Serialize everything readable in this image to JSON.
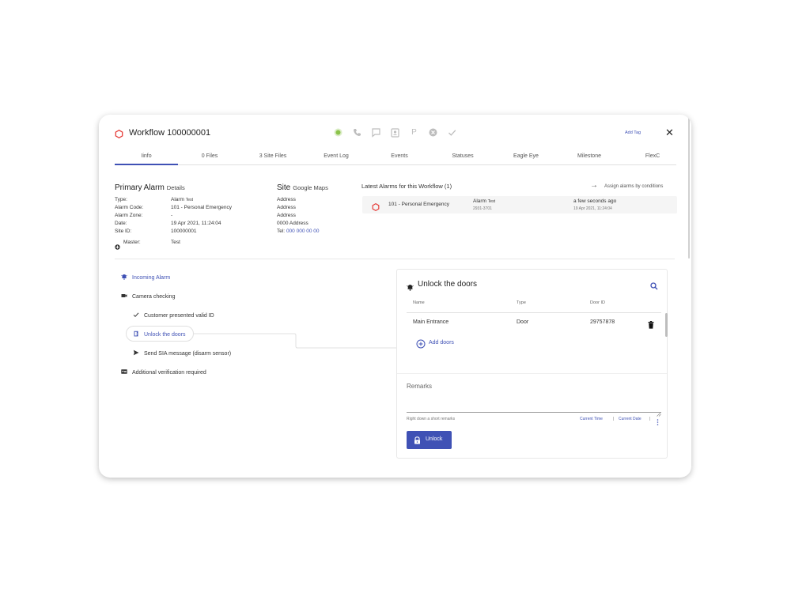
{
  "header": {
    "title": "Workflow 100000001",
    "add_tag": "Add Tag",
    "close_symbol": "✕",
    "toolbar_icons": [
      "status-dot-icon",
      "phone-icon",
      "chat-icon",
      "contact-icon",
      "parking-icon",
      "cancel-icon",
      "check-icon"
    ]
  },
  "tabs": [
    "Iinfo",
    "0 Files",
    "3 Site Files",
    "Event Log",
    "Events",
    "Statuses",
    "Eagle Eye",
    "Milestone",
    "FlexC"
  ],
  "primary_alarm": {
    "title": "Primary Alarm",
    "subtitle": "Details",
    "rows": [
      {
        "label": "Type:",
        "value": "Alarm",
        "extra": "Test"
      },
      {
        "label": "Alarm Code:",
        "value": "101 - Personal Emergency"
      },
      {
        "label": "Alarm Zone:",
        "value": "-"
      },
      {
        "label": "Date:",
        "value": "19 Apr 2021, 11:24:04"
      },
      {
        "label": "Site ID:",
        "value": "100000001"
      }
    ],
    "master_label": "Master:",
    "master_value": "Test"
  },
  "site": {
    "title": "Site",
    "subtitle": "Google Maps",
    "lines": [
      "Address",
      "Address",
      "Address",
      "0000 Address"
    ],
    "tel_label": "Tel:",
    "tel_value": "000 000 00 00"
  },
  "latest_alarms": {
    "title": "Latest Alarms for this Workflow (1)",
    "assign": "Assign alarms by conditions",
    "arrow": "→",
    "row": {
      "name": "101 - Personal Emergency",
      "type": "Alarm",
      "type_extra": "Test",
      "code": "2931-3701",
      "when": "a few seconds ago",
      "date": "19 Apr 2021, 11:24:04"
    }
  },
  "workflow_steps": [
    {
      "label": "Incoming Alarm",
      "icon": "alarm-bell-icon"
    },
    {
      "label": "Camera checking",
      "icon": "camera-icon"
    },
    {
      "label": "Customer presented valid ID",
      "icon": "check-icon"
    },
    {
      "label": "Unlock the doors",
      "icon": "door-icon"
    },
    {
      "label": "Send SIA message (disarm sensor)",
      "icon": "send-icon"
    },
    {
      "label": "Additional verification required",
      "icon": "id-card-icon"
    }
  ],
  "panel": {
    "title": "Unlock the doors",
    "columns": [
      "Name",
      "Type",
      "Door ID"
    ],
    "rows": [
      {
        "name": "Main Entrance",
        "type": "Door",
        "door_id": "29757878"
      }
    ],
    "add_doors": "Add doors",
    "remarks_label": "Remarks",
    "remarks_hint": "Right down a short remarks",
    "current_time": "Current Time",
    "current_date": "Current Date",
    "separator": "|",
    "unlock_button": "Unlock"
  },
  "colors": {
    "accent": "#3f51b5",
    "alarm_red": "#e53935",
    "status_green": "#8bc34a"
  }
}
